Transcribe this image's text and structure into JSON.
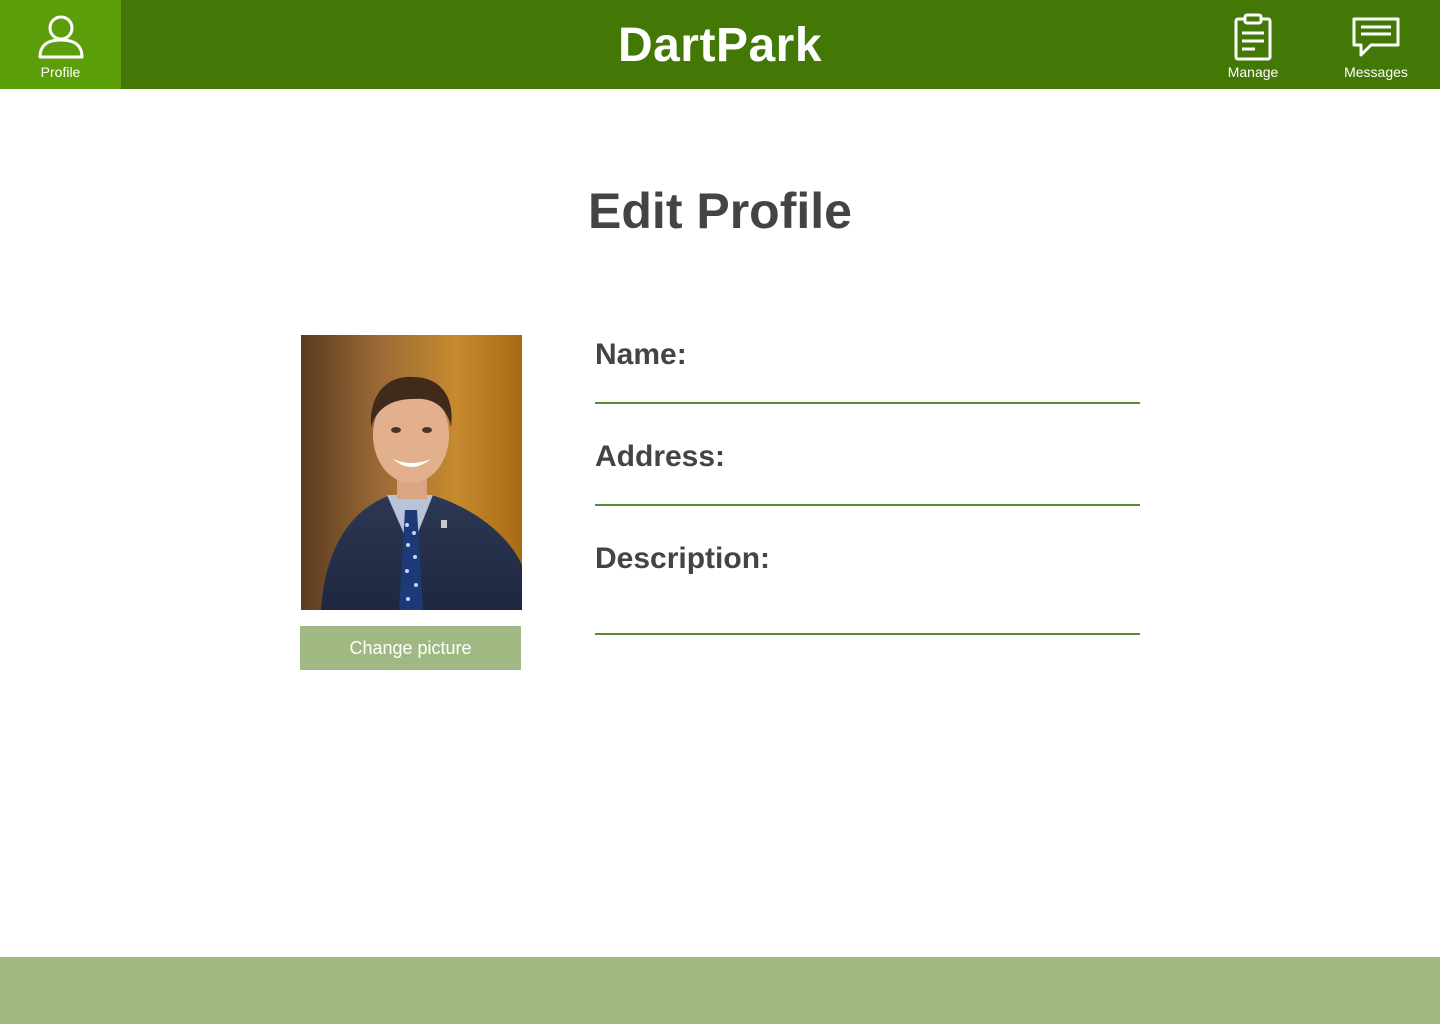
{
  "app": {
    "title": "DartPark"
  },
  "nav": {
    "profile_label": "Profile",
    "profile_icon": "user-icon",
    "manage_label": "Manage",
    "manage_icon": "clipboard-icon",
    "messages_label": "Messages",
    "messages_icon": "chat-icon"
  },
  "page": {
    "title": "Edit Profile"
  },
  "profile": {
    "change_picture_label": "Change picture",
    "name_label": "Name:",
    "name_value": "",
    "address_label": "Address:",
    "address_value": "",
    "description_label": "Description:",
    "description_value": ""
  },
  "colors": {
    "header": "#437806",
    "active_tab": "#5b9e0a",
    "accent_light": "#a0b982",
    "field_underline": "#5d8a32",
    "text_dark": "#444444"
  }
}
